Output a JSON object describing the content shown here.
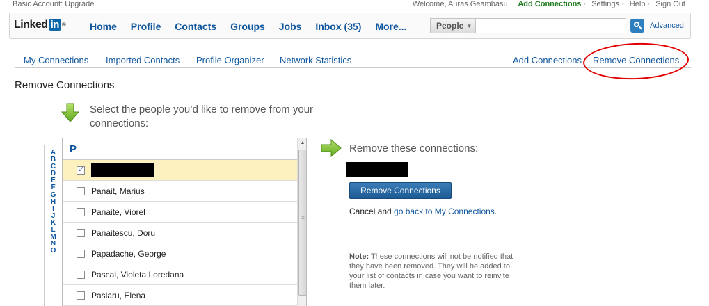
{
  "topbar": {
    "account": "Basic Account: Upgrade",
    "welcome": "Welcome, Auras Geambasu",
    "add_connections": "Add Connections",
    "settings": "Settings",
    "help": "Help",
    "sign_out": "Sign Out",
    "separator": "·"
  },
  "logo": {
    "text": "Linked",
    "in": "in",
    "reg": "®"
  },
  "nav": {
    "home": "Home",
    "profile": "Profile",
    "contacts": "Contacts",
    "groups": "Groups",
    "jobs": "Jobs",
    "inbox": "Inbox (35)",
    "more": "More..."
  },
  "search": {
    "scope": "People",
    "advanced": "Advanced"
  },
  "subnav": {
    "my_connections": "My Connections",
    "imported_contacts": "Imported Contacts",
    "profile_organizer": "Profile Organizer",
    "network_statistics": "Network Statistics",
    "add_connections": "Add Connections",
    "remove_connections": "Remove Connections"
  },
  "page_title": "Remove Connections",
  "instruction": "Select the people you’d like to remove from your connections:",
  "alphabet": [
    "A",
    "B",
    "C",
    "D",
    "E",
    "F",
    "G",
    "H",
    "I",
    "J",
    "K",
    "L",
    "M",
    "N",
    "O"
  ],
  "list": {
    "group_letter": "P",
    "rows": [
      {
        "name": "",
        "checked": true,
        "redacted": true
      },
      {
        "name": "Panait, Marius",
        "checked": false
      },
      {
        "name": "Panaite, Viorel",
        "checked": false
      },
      {
        "name": "Panaitescu, Doru",
        "checked": false
      },
      {
        "name": "Papadache, George",
        "checked": false
      },
      {
        "name": "Pascal, Violeta Loredana",
        "checked": false
      },
      {
        "name": "Paslaru, Elena",
        "checked": false
      }
    ]
  },
  "right_panel": {
    "title": "Remove these connections:",
    "button": "Remove Connections",
    "cancel_prefix": "Cancel and ",
    "cancel_link": "go back to My Connections",
    "cancel_suffix": ".",
    "note_label": "Note:",
    "note_text": " These connections will not be notified that they have been removed. They will be added to your list of contacts in case you want to reinvite them later."
  },
  "colors": {
    "link": "#10579e",
    "accent_green": "#1e7a1e",
    "highlight": "#fdf1c0",
    "circle": "#e00000"
  }
}
